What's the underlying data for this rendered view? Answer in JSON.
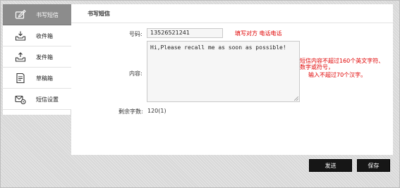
{
  "sidebar": {
    "items": [
      {
        "label": "书写短信",
        "icon": "compose-icon",
        "active": true
      },
      {
        "label": "收件箱",
        "icon": "inbox-icon",
        "active": false
      },
      {
        "label": "发件箱",
        "icon": "outbox-icon",
        "active": false
      },
      {
        "label": "草稿箱",
        "icon": "drafts-icon",
        "active": false
      },
      {
        "label": "短信设置",
        "icon": "sms-settings-icon",
        "active": false
      }
    ]
  },
  "main": {
    "title": "书写短信",
    "number": {
      "label": "号码:",
      "value": "13526521241",
      "hint": "填写对方 电话电话"
    },
    "content": {
      "label": "内容:",
      "value": "Hi,Please recall me as soon as possible!",
      "hint_line1": "短信内容不超过160个英文字符、",
      "hint_line2": "数字或符号，",
      "hint_line3": "输入不超过70个汉字。"
    },
    "remaining": {
      "label": "剩余字数:",
      "value": "120(1)"
    }
  },
  "actions": {
    "send_label": "发送",
    "save_label": "保存"
  },
  "colors": {
    "active_nav": "#8c8c8c",
    "hint": "#e00000",
    "button": "#161616"
  }
}
